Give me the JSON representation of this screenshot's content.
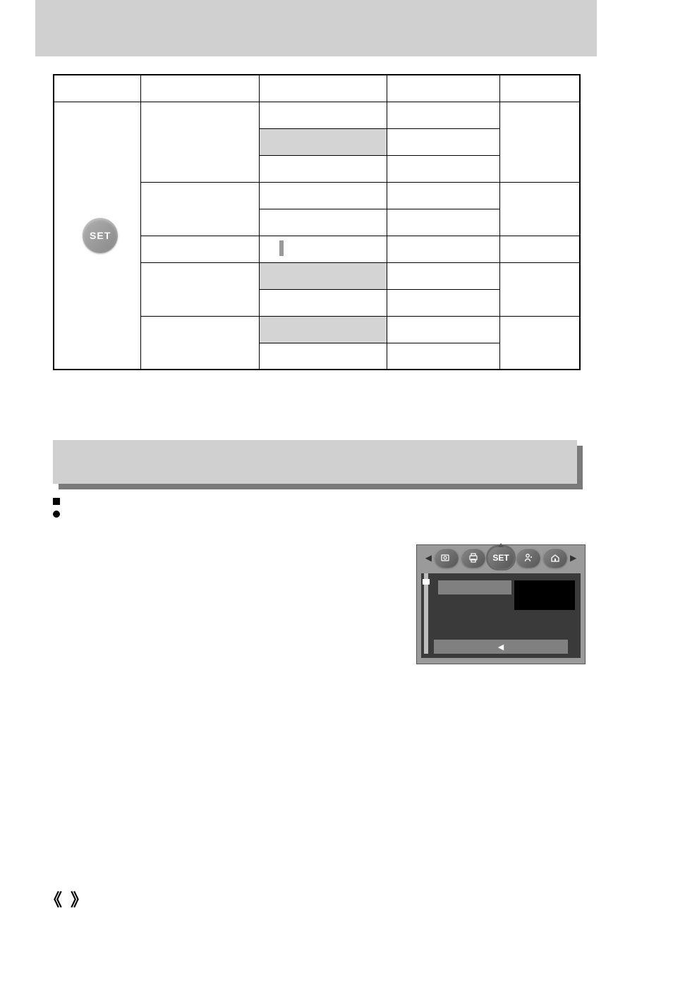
{
  "table": {
    "headers": [
      "",
      "",
      "",
      "",
      ""
    ],
    "icon_label": "SET",
    "rows": [
      {
        "c1": "",
        "c2": "",
        "c3": "",
        "c4": "",
        "shaded": false
      },
      {
        "c1": "",
        "c2": "",
        "c3": "",
        "c4": "",
        "shaded": true
      },
      {
        "c1": "",
        "c2": "",
        "c3": "",
        "c4": "",
        "shaded": false
      },
      {
        "c1": "",
        "c2": "",
        "c3": "",
        "c4": "",
        "shaded": false
      },
      {
        "c1": "",
        "c2": "",
        "c3": "",
        "c4": "",
        "shaded": false
      },
      {
        "c1": "",
        "c2": "",
        "c3": "",
        "c4": "",
        "shaded": false
      },
      {
        "c1": "",
        "c2": "",
        "c3": "",
        "c4": "",
        "shaded": true
      },
      {
        "c1": "",
        "c2": "",
        "c3": "",
        "c4": "",
        "shaded": false
      },
      {
        "c1": "",
        "c2": "",
        "c3": "",
        "c4": "",
        "shaded": true
      },
      {
        "c1": "",
        "c2": "",
        "c3": "",
        "c4": "",
        "shaded": false
      }
    ]
  },
  "section_title": "",
  "bullets": {
    "b1": "",
    "b2": ""
  },
  "menu": {
    "arrow_left": "◀",
    "arrow_right": "▶",
    "tabs": {
      "t1_name": "play-icon",
      "t2_name": "print-icon",
      "t3_name": "set-icon",
      "t4_name": "user-icon",
      "t5_name": "home-icon",
      "t3_label": "SET"
    },
    "label": "",
    "value": "",
    "footer_arrow": "◀"
  },
  "page_number": "",
  "angle_open": "《",
  "angle_close": "》"
}
